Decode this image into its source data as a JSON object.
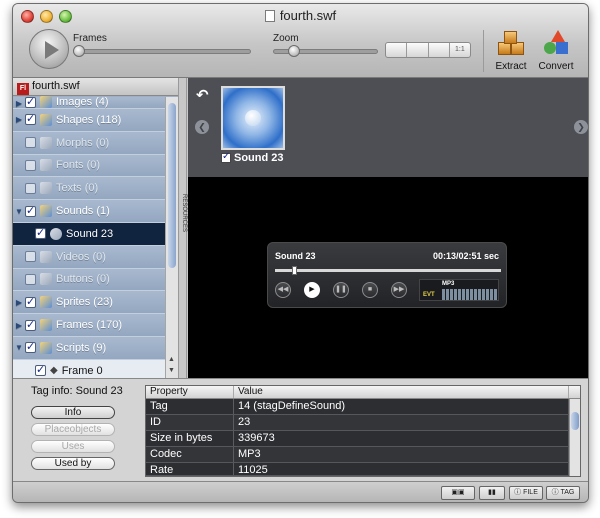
{
  "window": {
    "title": "fourth.swf"
  },
  "toolbar": {
    "frames_label": "Frames",
    "zoom_label": "Zoom",
    "zoom_segments": [
      "",
      "",
      "",
      "1:1"
    ],
    "extract_label": "Extract",
    "convert_label": "Convert"
  },
  "sidebar": {
    "file_name": "fourth.swf",
    "file_badge": "Fl",
    "items": [
      {
        "label": "Images (4)",
        "checked": true,
        "enabled": true,
        "expandable": true
      },
      {
        "label": "Shapes (118)",
        "checked": true,
        "enabled": true,
        "expandable": true
      },
      {
        "label": "Morphs (0)",
        "checked": false,
        "enabled": false,
        "expandable": false
      },
      {
        "label": "Fonts (0)",
        "checked": false,
        "enabled": false,
        "expandable": false
      },
      {
        "label": "Texts (0)",
        "checked": false,
        "enabled": false,
        "expandable": false
      },
      {
        "label": "Sounds (1)",
        "checked": true,
        "enabled": true,
        "expandable": true,
        "expanded": true
      },
      {
        "label": "Sound 23",
        "checked": true,
        "selected": true
      },
      {
        "label": "Videos (0)",
        "checked": false,
        "enabled": false,
        "expandable": false
      },
      {
        "label": "Buttons (0)",
        "checked": false,
        "enabled": false,
        "expandable": false
      },
      {
        "label": "Sprites (23)",
        "checked": true,
        "enabled": true,
        "expandable": true
      },
      {
        "label": "Frames (170)",
        "checked": true,
        "enabled": true,
        "expandable": true
      },
      {
        "label": "Scripts (9)",
        "checked": true,
        "enabled": true,
        "expandable": true,
        "expanded": true
      },
      {
        "label": "Frame 0",
        "checked": true
      }
    ],
    "resources_tab": "RESOURCES"
  },
  "preview": {
    "undo_glyph": "↶",
    "thumb_label": "Sound 23"
  },
  "player": {
    "title": "Sound 23",
    "time": "00:13/02:51 sec",
    "format": "MP3",
    "event": "EVT",
    "progress": 0.076,
    "buttons": [
      "rewind",
      "play",
      "pause",
      "stop",
      "forward"
    ]
  },
  "bottom": {
    "tag_info": "Tag info: Sound 23",
    "buttons": [
      {
        "label": "Info",
        "enabled": true,
        "active": true
      },
      {
        "label": "Placeobjects",
        "enabled": false
      },
      {
        "label": "Uses",
        "enabled": false
      },
      {
        "label": "Used by",
        "enabled": true
      }
    ],
    "table": {
      "headers": [
        "Property",
        "Value"
      ],
      "rows": [
        [
          "Tag",
          "14 (stagDefineSound)"
        ],
        [
          "ID",
          "23"
        ],
        [
          "Size in bytes",
          "339673"
        ],
        [
          "Codec",
          "MP3"
        ],
        [
          "Rate",
          "11025"
        ]
      ]
    }
  },
  "status": {
    "file_label": "FILE",
    "tag_label": "TAG"
  }
}
